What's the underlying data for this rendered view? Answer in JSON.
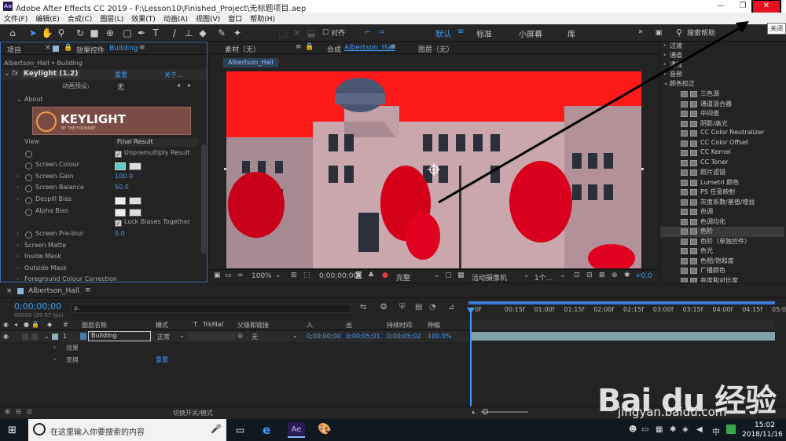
{
  "titlebar": {
    "app_badge": "Ae",
    "title": "Adobe After Effects CC 2019 - F:\\Lesson10\\Finished_Project\\无标题项目.aep",
    "minimize": "—",
    "restore": "❐",
    "close": "✕",
    "close_tooltip": "关闭"
  },
  "menubar": [
    "文件(F)",
    "编辑(E)",
    "合成(C)",
    "图层(L)",
    "效果(T)",
    "动画(A)",
    "视图(V)",
    "窗口",
    "帮助(H)"
  ],
  "toolbar": {
    "snap_label": "对齐",
    "workspaces": [
      "默认",
      "标准",
      "小屏幕",
      "库"
    ],
    "workspace_active": "默认",
    "search_help": "搜索帮助"
  },
  "left_panel": {
    "tab_project": "项目",
    "tab_effect_controls": "效果控件",
    "tab_effect_layer": "Building",
    "breadcrumb": "Albertson_Hall • Building",
    "effect_name": "Keylight (1.2)",
    "reset": "重置",
    "about": "关于...",
    "preset_label": "动画预设:",
    "preset_value": "无",
    "about_group": "About",
    "logo_text": "KEYLIGHT",
    "logo_sub": "BY THE FOUNDRY",
    "props": {
      "view_label": "View",
      "view_value": "Final Result",
      "unpremultiply": "Unpremultiply Result",
      "screen_colour": "Screen Colour",
      "screen_colour_hex": "#5fc7c6",
      "screen_gain": "Screen Gain",
      "screen_gain_value": "100.0",
      "screen_balance": "Screen Balance",
      "screen_balance_value": "50.0",
      "despill_bias": "Despill Bias",
      "alpha_bias": "Alpha Bias",
      "lock_biases": "Lock Biases Together",
      "screen_preblur": "Screen Pre-blur",
      "screen_preblur_value": "0.0",
      "screen_matte": "Screen Matte",
      "inside_mask": "Inside Mask",
      "outside_mask": "Outside Mask",
      "foreground_colour_correction": "Foreground Colour Correction"
    }
  },
  "viewer": {
    "tab_footage": "素材（无）",
    "tab_comp_prefix": "合成",
    "tab_comp_name": "Albertson_Hall",
    "tab_layer": "图层（无）",
    "comp_chip": "Albertson_Hall",
    "zoom": "100%",
    "timecode": "0;00;00;00",
    "resolution": "完整",
    "camera": "活动摄像机",
    "views": "1个...",
    "exposure": "+0.0"
  },
  "effects_panel": {
    "categories": [
      "过渡",
      "通道",
      "透视",
      "音频"
    ],
    "open_category": "颜色校正",
    "items": [
      "三色调",
      "通道混合器",
      "中间值",
      "阴影/高光",
      "CC Color Neutralizer",
      "CC Color Offset",
      "CC Kernel",
      "CC Toner",
      "照片滤镜",
      "Lumetri 颜色",
      "PS 任意映射",
      "灰度系数/基值/增益",
      "色调",
      "色调均化",
      "色阶",
      "色阶（单独控件）",
      "色光",
      "色相/饱和度",
      "广播颜色",
      "亮度和对比度"
    ],
    "selected_item": "色阶"
  },
  "timeline": {
    "tab": "Albertson_Hall",
    "current_time": "0;00;00;00",
    "fps": "00000 (29.97 fps)",
    "search_placeholder": "ρ.",
    "headers": {
      "layer_name": "图层名称",
      "mode": "模式",
      "trkmat": "TrkMat",
      "parent": "父级和链接",
      "in": "入",
      "out": "出",
      "duration": "持续时间",
      "stretch": "伸缩"
    },
    "layer": {
      "index": "1",
      "name": "Building",
      "mode": "正常",
      "parent": "无",
      "in": "0;00;00;00",
      "out": "0;00;05;01",
      "duration": "0;00;05;02",
      "stretch": "100.0%"
    },
    "sub_effects": "效果",
    "sub_transform": "变换",
    "sub_transform_reset": "重置",
    "ruler": [
      "0f",
      "00:15f",
      "01:00f",
      "01:15f",
      "02:00f",
      "02:15f",
      "03:00f",
      "03:15f",
      "04:00f",
      "04:15f",
      "05:0"
    ],
    "footer_toggle": "切换开关/模式"
  },
  "taskbar": {
    "search_placeholder": "在这里输入你要搜索的内容",
    "time": "15:02",
    "date": "2018/11/16",
    "ae_label": "Ae"
  },
  "watermark": {
    "brand": "Bai du 经验",
    "url": "jingyan.baidu.com"
  },
  "colors": {
    "accent": "#3e9bff",
    "close": "#e81123",
    "annotation": "#000000"
  }
}
